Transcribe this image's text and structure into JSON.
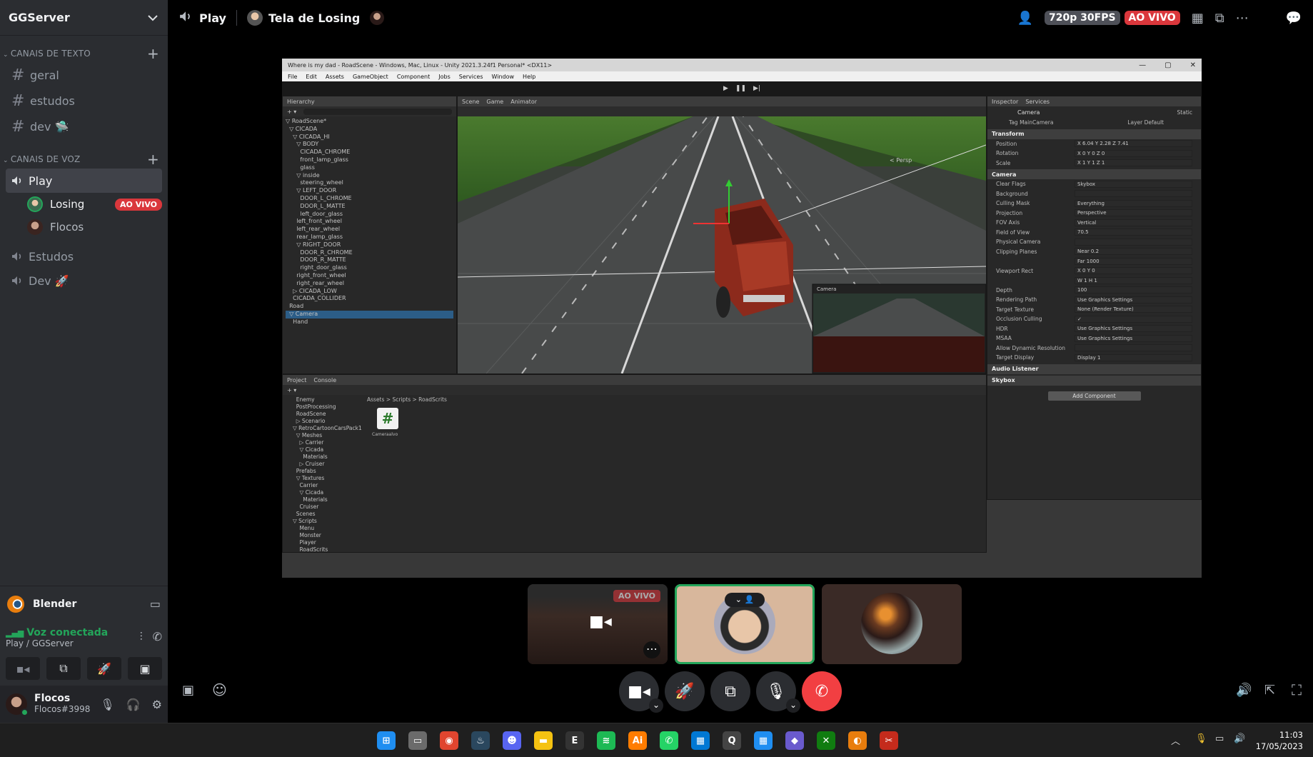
{
  "server": {
    "name": "GGServer"
  },
  "text_category": "CANAIS DE TEXTO",
  "text_channels": [
    "geral",
    "estudos",
    "dev 🛸"
  ],
  "voice_category": "CANAIS DE VOZ",
  "voice_channels": {
    "play": "Play",
    "play_users": [
      {
        "name": "Losing",
        "badge": "AO VIVO"
      },
      {
        "name": "Flocos"
      }
    ],
    "estudos": "Estudos",
    "dev": "Dev 🚀"
  },
  "activity": {
    "app": "Blender"
  },
  "voice_status": {
    "status": "Voz conectada",
    "location": "Play / GGServer"
  },
  "user": {
    "name": "Flocos",
    "tag": "Flocos#3998"
  },
  "topbar": {
    "channel": "Play",
    "streamer": "Tela de Losing",
    "quality": "720p 30FPS",
    "live": "AO VIVO"
  },
  "unity": {
    "title": "Where is my dad - RoadScene - Windows, Mac, Linux - Unity 2021.3.24f1 Personal* <DX11>",
    "menu": [
      "File",
      "Edit",
      "Assets",
      "GameObject",
      "Component",
      "Jobs",
      "Services",
      "Window",
      "Help"
    ],
    "hierarchy_tab": "Hierarchy",
    "hierarchy": [
      "▽ RoadScene*",
      "  ▽ CICADA",
      "    ▽ CICADA_HI",
      "      ▽ BODY",
      "        CICADA_CHROME",
      "        front_lamp_glass",
      "        glass",
      "      ▽ inside",
      "        steering_wheel",
      "      ▽ LEFT_DOOR",
      "        DOOR_L_CHROME",
      "        DOOR_L_MATTE",
      "        left_door_glass",
      "      left_front_wheel",
      "      left_rear_wheel",
      "      rear_lamp_glass",
      "      ▽ RIGHT_DOOR",
      "        DOOR_R_CHROME",
      "        DOOR_R_MATTE",
      "        right_door_glass",
      "      right_front_wheel",
      "      right_rear_wheel",
      "    ▷ CICADA_LOW",
      "    CICADA_COLLIDER",
      "  Road",
      "  ▽ Camera",
      "    Hand"
    ],
    "scene_tabs": [
      "Scene",
      "Game",
      "Animator"
    ],
    "camera_preview": "Camera",
    "persp": "< Persp",
    "project_tabs": [
      "Project",
      "Console"
    ],
    "project_tree": [
      "  Enemy",
      "  PostProcessing",
      "  RoadScene",
      "  ▷ Scenario",
      "▽ RetroCartoonCarsPack1",
      "  ▽ Meshes",
      "    ▷ Carrier",
      "    ▽ Cicada",
      "      Materials",
      "    ▷ Cruiser",
      "  Prefabs",
      "  ▽ Textures",
      "    Carrier",
      "    ▽ Cicada",
      "      Materials",
      "    Cruiser",
      "  Scenes",
      "▽ Scripts",
      "    Menu",
      "    Monster",
      "    Player",
      "    RoadScrits"
    ],
    "breadcrumb": "Assets > Scripts > RoadScrits",
    "script_name": "Cameraalvo",
    "inspector_tabs": [
      "Inspector",
      "Services"
    ],
    "object_name": "Camera",
    "static_label": "Static",
    "tag": "Tag  MainCamera",
    "layer": "Layer  Default",
    "transform": "Transform",
    "transform_rows": [
      {
        "k": "Position",
        "v": "X 6.04    Y 2.28    Z 7.41"
      },
      {
        "k": "Rotation",
        "v": "X 0    Y 0    Z 0"
      },
      {
        "k": "Scale",
        "v": "X 1    Y 1    Z 1"
      }
    ],
    "camera_comp": "Camera",
    "camera_rows": [
      {
        "k": "Clear Flags",
        "v": "Skybox"
      },
      {
        "k": "Background",
        "v": ""
      },
      {
        "k": "Culling Mask",
        "v": "Everything"
      },
      {
        "k": "Projection",
        "v": "Perspective"
      },
      {
        "k": "FOV Axis",
        "v": "Vertical"
      },
      {
        "k": "Field of View",
        "v": "70.5"
      },
      {
        "k": "Physical Camera",
        "v": ""
      },
      {
        "k": "Clipping Planes",
        "v": "Near  0.2"
      },
      {
        "k": "",
        "v": "Far  1000"
      },
      {
        "k": "Viewport Rect",
        "v": "X 0    Y 0"
      },
      {
        "k": "",
        "v": "W 1    H 1"
      },
      {
        "k": "Depth",
        "v": "100"
      },
      {
        "k": "Rendering Path",
        "v": "Use Graphics Settings"
      },
      {
        "k": "Target Texture",
        "v": "None (Render Texture)"
      },
      {
        "k": "Occlusion Culling",
        "v": "✓"
      },
      {
        "k": "HDR",
        "v": "Use Graphics Settings"
      },
      {
        "k": "MSAA",
        "v": "Use Graphics Settings"
      },
      {
        "k": "Allow Dynamic Resolution",
        "v": ""
      },
      {
        "k": "Target Display",
        "v": "Display 1"
      }
    ],
    "audio_listener": "Audio Listener",
    "skybox": "Skybox",
    "add_component": "Add Component"
  },
  "tiles": {
    "live_badge": "AO VIVO"
  },
  "clock": {
    "time": "11:03",
    "date": "17/05/2023"
  },
  "taskbar_icons": [
    "start-icon",
    "taskview-icon",
    "chrome-icon",
    "steam-icon",
    "discord-icon",
    "explorer-icon",
    "epic-icon",
    "spotify-icon",
    "illustrator-icon",
    "whatsapp-icon",
    "store-icon",
    "q-icon",
    "calendar-icon",
    "app-icon",
    "xbox-icon",
    "blender-icon",
    "snip-icon"
  ],
  "colors": {
    "accent_green": "#23a55a",
    "live_red": "#da373c",
    "end_call_red": "#f23f42"
  }
}
